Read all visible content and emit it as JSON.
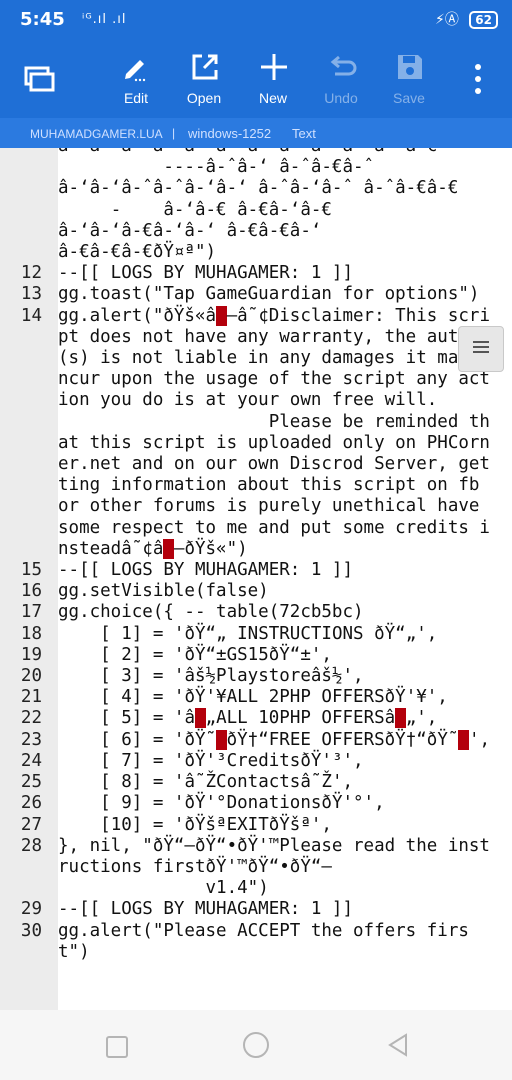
{
  "status_bar": {
    "time": "5:45",
    "signal": "ⁱᴳ.ıl .ıl",
    "right_icons": "⚡Ⓐ",
    "battery": "62"
  },
  "toolbar": {
    "buttons": [
      {
        "label": "Edit",
        "icon": "pencil-icon",
        "enabled": true
      },
      {
        "label": "Open",
        "icon": "open-external-icon",
        "enabled": true
      },
      {
        "label": "New",
        "icon": "plus-icon",
        "enabled": true
      },
      {
        "label": "Undo",
        "icon": "undo-icon",
        "enabled": false
      },
      {
        "label": "Save",
        "icon": "save-icon",
        "enabled": false
      }
    ],
    "menu_icon": "more-vert-icon"
  },
  "file_bar": {
    "name": "MUHAMADGAMER.LUA",
    "separator": "|",
    "encoding": "windows-1252",
    "language": "Text"
  },
  "editor": {
    "lines": [
      {
        "n": "",
        "text": "â-‘â-ˆâ-‘â-ˆâ-‘â-‘â-ˆâ-‘â-ˆâ-‘â-‘â-€"
      },
      {
        "n": "",
        "text": "          ----â-ˆâ-‘ â-ˆâ-€â-ˆ"
      },
      {
        "n": "",
        "text": "â-‘â-‘â-ˆâ-ˆâ-‘â-‘ â-ˆâ-‘â-ˆ â-ˆâ-€â-€"
      },
      {
        "n": "",
        "text": "     -    â-‘â-€ â-€â-‘â-€"
      },
      {
        "n": "",
        "text": "â-‘â-‘â-€â-‘â-‘ â-€â-€â-‘"
      },
      {
        "n": "",
        "text": "â-€â-€â-€ðŸ¤ª\")"
      },
      {
        "n": "12",
        "text": "--[[ LOGS BY MUHAGAMER: 1 ]]"
      },
      {
        "n": "13",
        "text": "gg.toast(\"Tap GameGuardian for options\")"
      },
      {
        "n": "14",
        "text": "gg.alert(\"ðŸš«â█–â˜¢Disclaimer: This script does not have any warranty, the author(s) is not liable in any damages it may incur upon the usage of the script any action you do is at your own free will.\n                    Please be reminded that this script is uploaded only on PHCorner.net and on our own Discrod Server, getting information about this script on fb or other forums is purely unethical have some respect to me and put some credits insteadâ˜¢â█–ðŸš«\")"
      },
      {
        "n": "15",
        "text": "--[[ LOGS BY MUHAGAMER: 1 ]]"
      },
      {
        "n": "16",
        "text": "gg.setVisible(false)"
      },
      {
        "n": "17",
        "text": "gg.choice({ -- table(72cb5bc)"
      },
      {
        "n": "18",
        "text": "    [ 1] = 'ðŸ“„ INSTRUCTIONS ðŸ“„',"
      },
      {
        "n": "19",
        "text": "    [ 2] = 'ðŸ“±GS15ðŸ“±',"
      },
      {
        "n": "20",
        "text": "    [ 3] = 'âš½Playstoreâš½',"
      },
      {
        "n": "21",
        "text": "    [ 4] = 'ðŸ'¥ALL 2PHP OFFERSðŸ'¥',"
      },
      {
        "n": "22",
        "text": "    [ 5] = 'â█„ALL 10PHP OFFERSâ█„',"
      },
      {
        "n": "23",
        "text": "    [ 6] = 'ðŸ˜█ðŸ†“FREE OFFERSðŸ†“ðŸ˜█',"
      },
      {
        "n": "24",
        "text": "    [ 7] = 'ðŸ'³CreditsðŸ'³',"
      },
      {
        "n": "25",
        "text": "    [ 8] = 'â˜ŽContactsâ˜Ž',"
      },
      {
        "n": "26",
        "text": "    [ 9] = 'ðŸ'°DonationsðŸ'°',"
      },
      {
        "n": "27",
        "text": "    [10] = 'ðŸšªEXITðŸšª',"
      },
      {
        "n": "28",
        "text": "}, nil, \"ðŸ“–ðŸ“•ðŸ'™Please read the instructions firstðŸ'™ðŸ“•ðŸ“–\n              v1.4\")"
      },
      {
        "n": "29",
        "text": "--[[ LOGS BY MUHAGAMER: 1 ]]"
      },
      {
        "n": "30",
        "text": "gg.alert(\"Please ACCEPT the offers first\")"
      }
    ]
  },
  "nav_bar": {
    "icons": [
      "recents-square-icon",
      "home-circle-icon",
      "back-triangle-icon"
    ]
  }
}
